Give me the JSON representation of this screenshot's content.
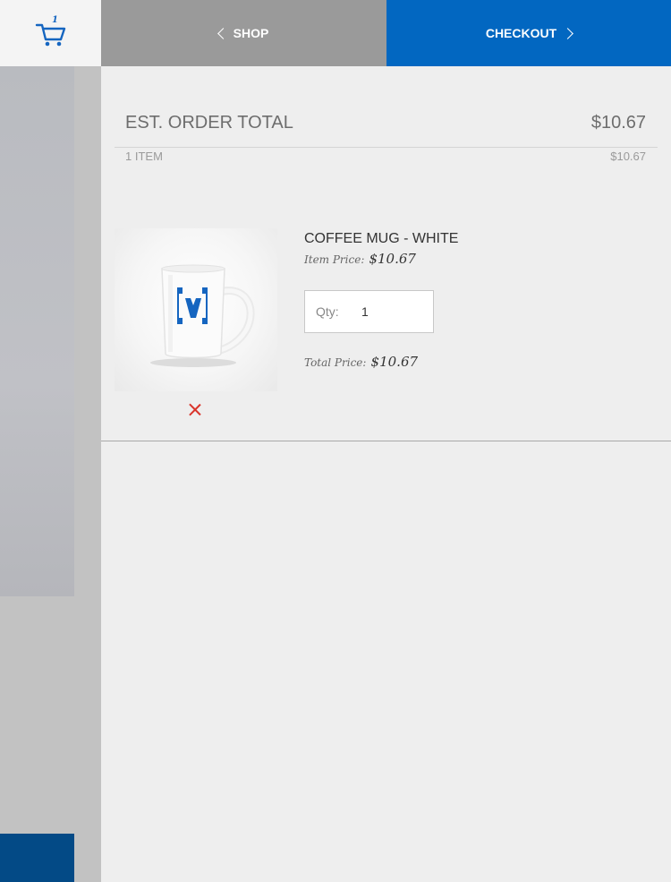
{
  "header": {
    "cart_count": "1",
    "shop_label": "SHOP",
    "checkout_label": "CHECKOUT"
  },
  "summary": {
    "total_label": "EST. ORDER TOTAL",
    "total_value": "$10.67",
    "items_label": "1 ITEM",
    "items_value": "$10.67"
  },
  "line_item": {
    "name": "COFFEE MUG - WHITE",
    "item_price_label": "Item Price:",
    "item_price": "$10.67",
    "qty_label": "Qty:",
    "qty_value": "1",
    "total_price_label": "Total Price:",
    "total_price": "$10.67"
  },
  "icons": {
    "cart": "cart-icon",
    "remove": "close-icon"
  },
  "colors": {
    "checkout_blue": "#0267c1",
    "shop_gray": "#9a9a9a",
    "remove_red": "#d9342b",
    "logo_blue": "#1565c0"
  }
}
